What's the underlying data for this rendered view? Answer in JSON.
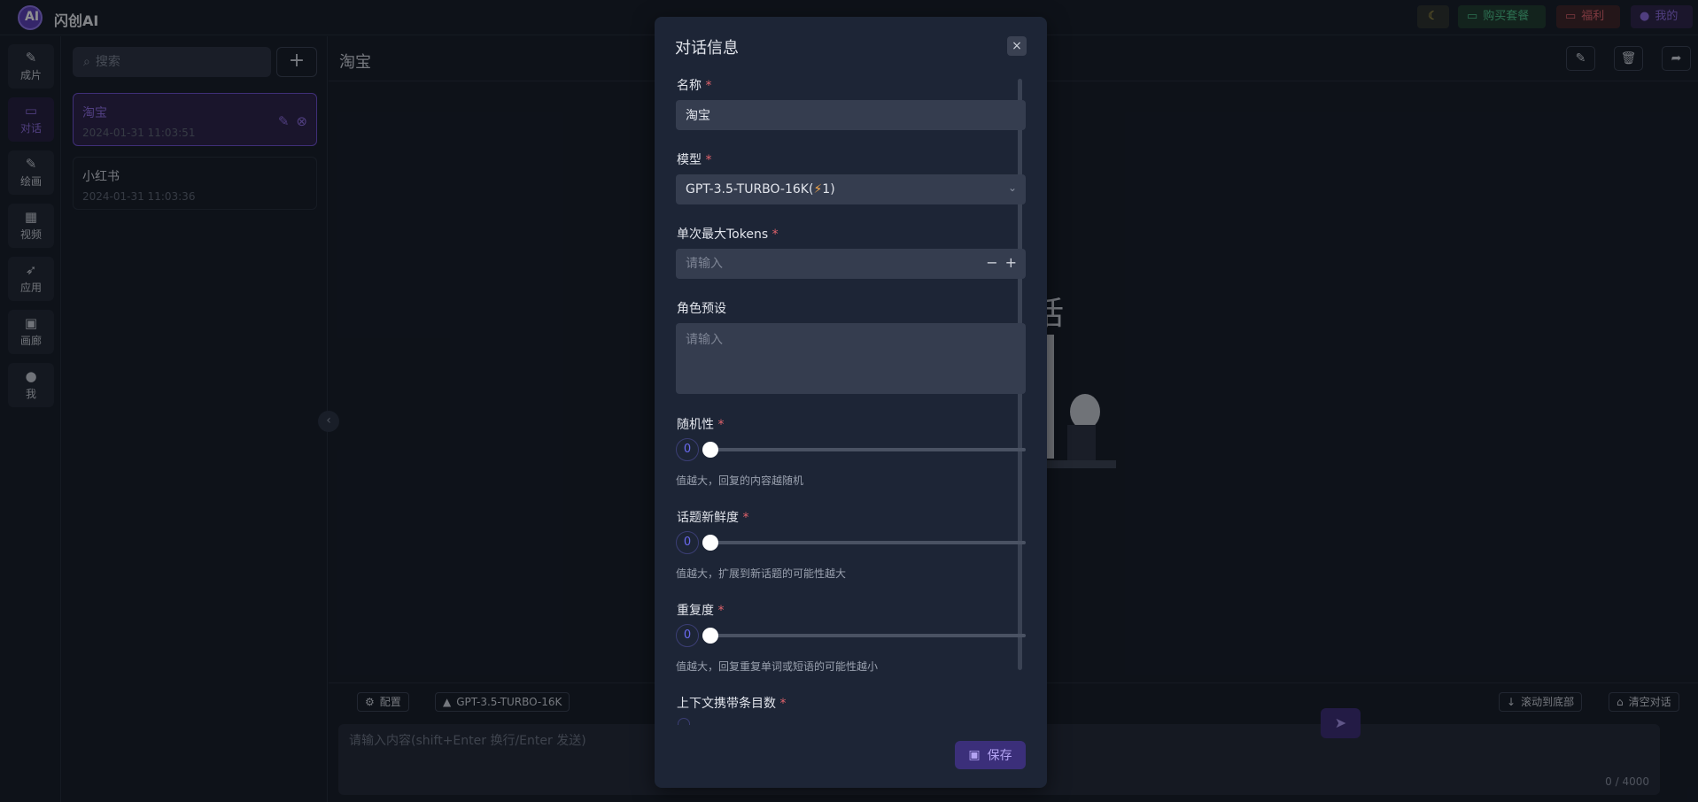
{
  "app": {
    "brand": "闪创AI",
    "logo_mark": "AI"
  },
  "topbar": {
    "theme_icon": "☾",
    "buy_label": "购买套餐",
    "welfare_label": "福利",
    "mine_label": "我的"
  },
  "rail": [
    {
      "icon": "✎",
      "label": "成片"
    },
    {
      "icon": "▭",
      "label": "对话"
    },
    {
      "icon": "✎",
      "label": "绘画"
    },
    {
      "icon": "▦",
      "label": "视频"
    },
    {
      "icon": "➶",
      "label": "应用"
    },
    {
      "icon": "▣",
      "label": "画廊"
    },
    {
      "icon": "●",
      "label": "我"
    }
  ],
  "list": {
    "search_placeholder": "搜索",
    "add_icon": "+",
    "conversations": [
      {
        "title": "淘宝",
        "date": "2024-01-31 11:03:51"
      },
      {
        "title": "小红书",
        "date": "2024-01-31 11:03:36"
      }
    ]
  },
  "main": {
    "title": "淘宝",
    "illustration_text": "话",
    "collapse_icon": "‹",
    "chips": {
      "config": "配置",
      "model": "GPT-3.5-TURBO-16K",
      "scroll": "滚动到底部",
      "clear": "清空对话"
    },
    "composer_placeholder": "请输入内容(shift+Enter 换行/Enter 发送)",
    "counter": "0 / 4000"
  },
  "modal": {
    "title": "对话信息",
    "close_icon": "×",
    "name_label": "名称",
    "name_value": "淘宝",
    "model_label": "模型",
    "model_value_prefix": "GPT-3.5-TURBO-16K(",
    "model_bolt": "⚡",
    "model_value_suffix": " 1)",
    "tokens_label": "单次最大Tokens",
    "tokens_placeholder": "请输入",
    "role_label": "角色预设",
    "role_placeholder": "请输入",
    "temperature_label": "随机性",
    "temperature_value": "0",
    "temperature_hint": "值越大，回复的内容越随机",
    "presence_label": "话题新鲜度",
    "presence_value": "0",
    "presence_hint": "值越大，扩展到新话题的可能性越大",
    "frequency_label": "重复度",
    "frequency_value": "0",
    "frequency_hint": "值越大，回复重复单词或短语的可能性越小",
    "context_label": "上下文携带条目数",
    "required_mark": "*",
    "save_label": "保存"
  }
}
